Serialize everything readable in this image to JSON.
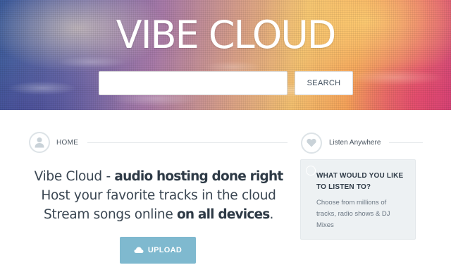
{
  "hero": {
    "title": "VIBE CLOUD",
    "search": {
      "placeholder": "",
      "value": "",
      "button_label": "SEARCH"
    }
  },
  "main": {
    "section_label": "HOME",
    "section_icon": "user-icon",
    "headline": {
      "line1_prefix": "Vibe Cloud - ",
      "line1_bold": "audio hosting done right",
      "line2": "Host your favorite tracks in the cloud",
      "line3_prefix": "Stream songs online ",
      "line3_bold": "on all devices",
      "line3_suffix": "."
    },
    "upload": {
      "label": "UPLOAD",
      "icon": "cloud-icon",
      "color": "#7fb9cf"
    }
  },
  "sidebar": {
    "section_label": "Listen Anywhere",
    "section_icon": "heart-icon",
    "card": {
      "title": "WHAT WOULD YOU LIKE TO LISTEN TO?",
      "description": "Choose from millions of tracks, radio shows & DJ Mixes",
      "background": "#edf1f3"
    }
  }
}
